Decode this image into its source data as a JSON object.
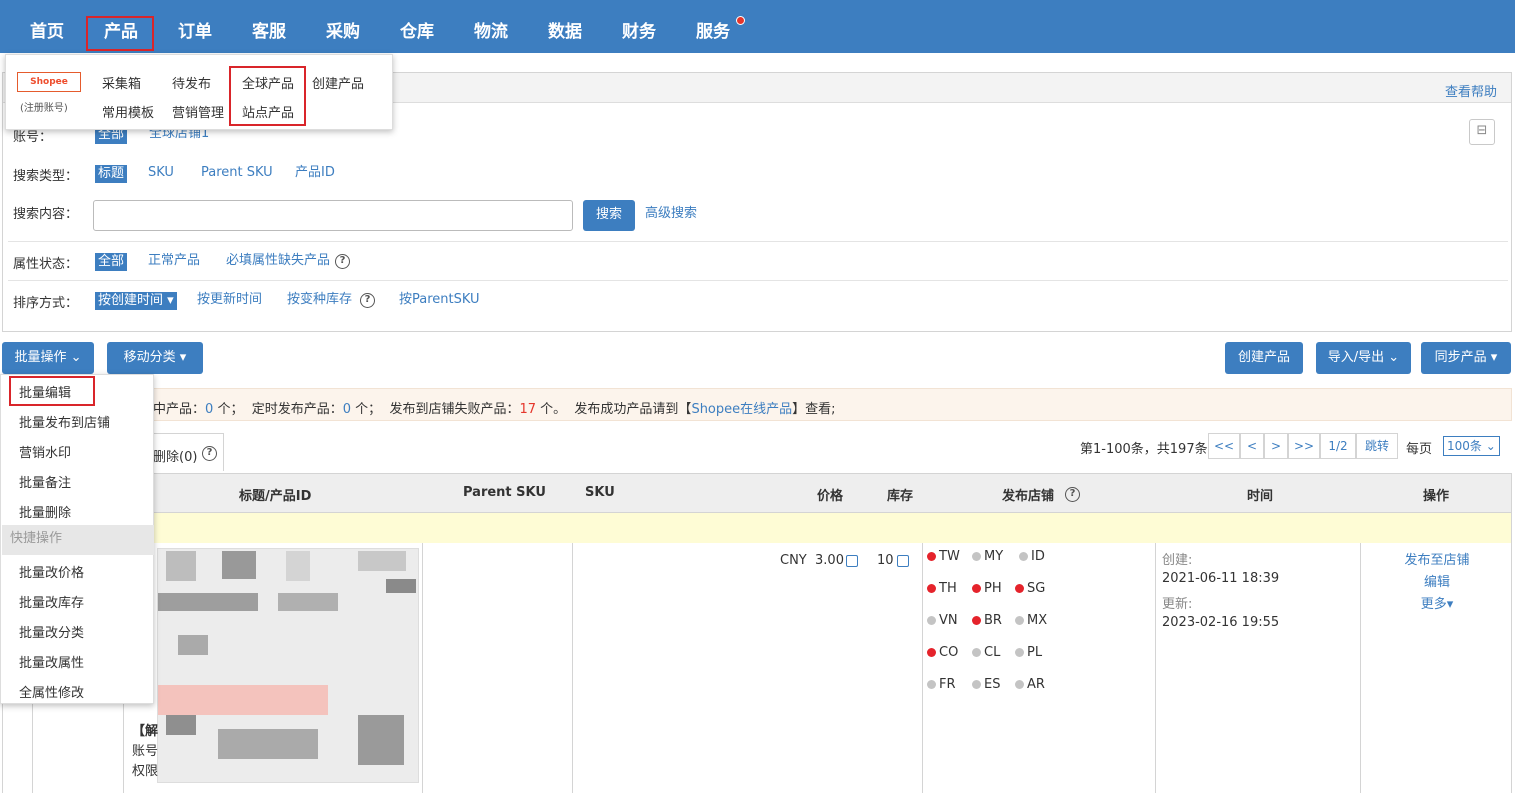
{
  "nav": {
    "items": [
      "首页",
      "产品",
      "订单",
      "客服",
      "采购",
      "仓库",
      "物流",
      "数据",
      "财务",
      "服务"
    ],
    "active": "产品"
  },
  "panel": {
    "help": "查看帮助",
    "account_label": "账号：",
    "account_all": "全部",
    "account_store": "全球店铺1",
    "search_type_label": "搜索类型：",
    "search_types": [
      "标题",
      "SKU",
      "Parent SKU",
      "产品ID"
    ],
    "search_content_label": "搜索内容：",
    "search_value": "",
    "search_button": "搜索",
    "advanced_search": "高级搜索",
    "attr_label": "属性状态：",
    "attr_options": [
      "全部",
      "正常产品",
      "必填属性缺失产品"
    ],
    "sort_label": "排序方式：",
    "sort_options": [
      "按创建时间",
      "按更新时间",
      "按变种库存",
      "按ParentSKU"
    ]
  },
  "toolbar": {
    "batch": "批量操作",
    "move_category": "移动分类",
    "create_product": "创建产品",
    "import_export": "导入/导出",
    "sync_product": "同步产品"
  },
  "notice": {
    "pending_label": "中产品：",
    "pending_count": "0",
    "unit": "个；",
    "scheduled_label": "定时发布产品：",
    "scheduled_count": "0",
    "failed_label": "发布到店铺失败产品：",
    "failed_count": "17",
    "failed_unit": "个。",
    "tail_a": "发布成功产品请到【",
    "tail_link": "Shopee在线产品",
    "tail_b": "】查看;"
  },
  "tab": {
    "label": "删除(0)"
  },
  "pager": {
    "info": "第1-100条，共197条",
    "first": "<<",
    "prev": "<",
    "next": ">",
    "last": ">>",
    "page": "1/2",
    "jump": "跳转",
    "per_page_label": "每页",
    "per_page_value": "100条"
  },
  "table": {
    "headers": {
      "title": "标题/产品ID",
      "parent_sku": "Parent SKU",
      "sku": "SKU",
      "price": "价格",
      "stock": "库存",
      "stores": "发布店铺",
      "time": "时间",
      "ops": "操作"
    },
    "row": {
      "currency": "CNY",
      "price": "3.00",
      "stock": "10",
      "title_fragments": [
        "【解",
        "账号",
        "权限"
      ],
      "stores": [
        {
          "code": "TW",
          "status": "red"
        },
        {
          "code": "MY",
          "status": "grey"
        },
        {
          "code": "ID",
          "status": "grey"
        },
        {
          "code": "TH",
          "status": "red"
        },
        {
          "code": "PH",
          "status": "red"
        },
        {
          "code": "SG",
          "status": "red"
        },
        {
          "code": "VN",
          "status": "grey"
        },
        {
          "code": "BR",
          "status": "red"
        },
        {
          "code": "MX",
          "status": "grey"
        },
        {
          "code": "CO",
          "status": "red"
        },
        {
          "code": "CL",
          "status": "grey"
        },
        {
          "code": "PL",
          "status": "grey"
        },
        {
          "code": "FR",
          "status": "grey"
        },
        {
          "code": "ES",
          "status": "grey"
        },
        {
          "code": "AR",
          "status": "grey"
        }
      ],
      "created_label": "创建:",
      "created": "2021-06-11 18:39",
      "updated_label": "更新:",
      "updated": "2023-02-16 19:55",
      "ops": [
        "发布至店铺",
        "编辑",
        "更多"
      ]
    }
  },
  "product_menu": {
    "shopee": "Shopee",
    "shopee_sub": "(注册账号)",
    "items": [
      "采集箱",
      "待发布",
      "全球产品",
      "创建产品",
      "常用模板",
      "营销管理",
      "站点产品"
    ]
  },
  "batch_menu": {
    "items": [
      "批量编辑",
      "批量发布到店铺",
      "营销水印",
      "批量备注",
      "批量删除"
    ],
    "quick_header": "快捷操作",
    "quick_items": [
      "批量改价格",
      "批量改库存",
      "批量改分类",
      "批量改属性",
      "全属性修改"
    ]
  },
  "colors": {
    "primary": "#3d7ec0",
    "highlight": "#d9252a",
    "nav_bg": "#3d7ec0"
  }
}
